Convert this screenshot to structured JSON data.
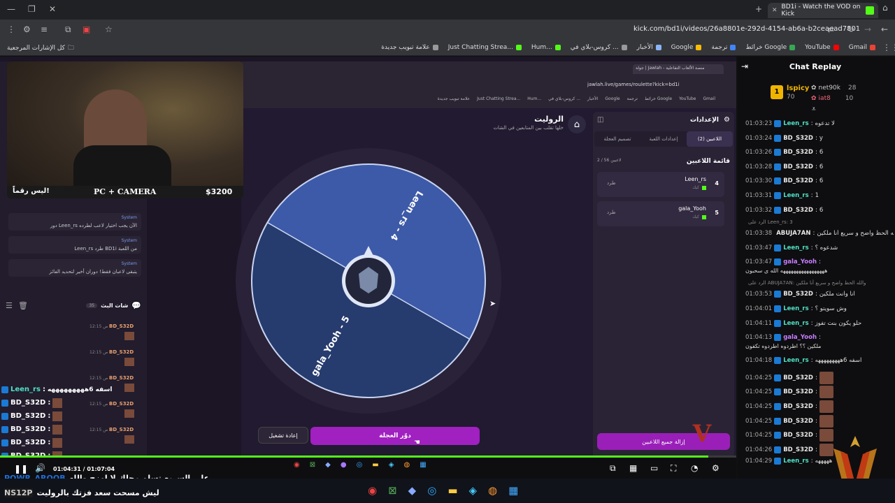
{
  "browser": {
    "tab_title": "BD1i - Watch the VOD on Kick",
    "new_tab": "+",
    "url": "kick.com/bd1i/videos/26a8801e-292d-4154-ab6a-b2ceaead7801",
    "bookmarks_folder": "كل الإشارات المرجعية",
    "bookmarks": [
      {
        "label": "Gmail",
        "color": "#ea4335"
      },
      {
        "label": "YouTube",
        "color": "#ff0000"
      },
      {
        "label": "خرائط Google",
        "color": "#34a853"
      },
      {
        "label": "ترجمة",
        "color": "#4285f4"
      },
      {
        "label": "Google",
        "color": "#fbbc05"
      },
      {
        "label": "الأخبار",
        "color": "#8ab4f8"
      },
      {
        "label": "كروس-بلاي في ...",
        "color": "#999999"
      },
      {
        "label": "Hum...",
        "color": "#53fc18"
      },
      {
        "label": "Just Chatting Strea...",
        "color": "#53fc18"
      },
      {
        "label": "علامة تبويب جديدة",
        "color": "#999999"
      }
    ]
  },
  "inner_browser": {
    "tab_title": "جولة | Jawlah - منصة الألعاب التفاعلية",
    "url": "jawlah.live/games/roulette?kick=bd1i",
    "bookmarks": [
      "Gmail",
      "YouTube",
      "خرائط Google",
      "ترجمة",
      "Google",
      "الأخبار",
      "كروس-بلاي في ...",
      "Hum...",
      "Just Chatting Strea...",
      "علامة تبويب جديدة"
    ]
  },
  "game": {
    "title": "الروليت",
    "subtitle": "خلها تقلب بين المتابعين في الشات",
    "wheel_segments": [
      "Leen_rs - 4",
      "gala_Yooh - 5"
    ],
    "spin_button": "دوّر العجلة",
    "replay_button": "إعادة تشغيل"
  },
  "settings": {
    "header": "الإعدادات",
    "tabs": [
      "اللاعبين (2)",
      "إعدادات اللعبة",
      "تصميم العجلة"
    ],
    "list_title": "قائمة اللاعبين",
    "count": "2 / 56 لاعبين",
    "players": [
      {
        "num": "4",
        "name": "Leen_rs",
        "sub": "كيك",
        "kick": "طرد"
      },
      {
        "num": "5",
        "name": "gala_Yooh",
        "sub": "كيك",
        "kick": "طرد"
      }
    ],
    "remove_all": "إزالة جميع اللاعبين"
  },
  "webcam": {
    "left_caption": "ليس رقماً!",
    "center_caption": "PC + CAMERA",
    "right_caption": "$3200"
  },
  "left_chat": {
    "header": "شات البث",
    "count": "35",
    "system_label": "System",
    "system_messages": [
      "دور Leen_rs الآن يجب اختيار لاعب لطرده",
      "Leen_rs طرد BD1i من اللعبة",
      "يتبقى لاعبان فقط! دوران أخير لتحديد الفائز"
    ],
    "mini_user": "BD_S32D",
    "mini_time": "12:15 ص",
    "overlay_lines": [
      {
        "user": "Leen_rs",
        "text": "اسفه 6هههههههههه"
      },
      {
        "user": "BD_S32D",
        "text": ""
      },
      {
        "user": "BD_S32D",
        "text": ""
      },
      {
        "user": "BD_S32D",
        "text": ""
      },
      {
        "user": "BD_S32D",
        "text": ""
      },
      {
        "user": "BD_S32D",
        "text": ""
      }
    ]
  },
  "player": {
    "current": "01:04:31",
    "sep": "/",
    "total": "01:07:04",
    "progress": 0.962
  },
  "subtitle_overlay": {
    "line1_user": "POWR_AROOB",
    "line1_text": "على السريع تسلم رجلك لا امزح والله",
    "line2_user": "NS12P",
    "line2_text": "ليش مسحت سعد فزتك بالروليت"
  },
  "chat_replay": {
    "title": "Chat Replay",
    "top_users": [
      {
        "rank": "1",
        "name": "lspicy",
        "count": "70"
      },
      {
        "name": "net90k",
        "count": "28"
      },
      {
        "name": "iat8",
        "count": "10"
      }
    ],
    "messages": [
      {
        "time": "01:03:23",
        "user": "Leen_rs",
        "color": "#4fe0c4",
        "text": "لا تدعوه"
      },
      {
        "time": "01:03:24",
        "user": "BD_S32D",
        "color": "#e8e8e8",
        "text": "y"
      },
      {
        "time": "01:03:26",
        "user": "BD_S32D",
        "color": "#e8e8e8",
        "text": "6"
      },
      {
        "time": "01:03:28",
        "user": "BD_S32D",
        "color": "#e8e8e8",
        "text": "6"
      },
      {
        "time": "01:03:30",
        "user": "BD_S32D",
        "color": "#e8e8e8",
        "text": "6"
      },
      {
        "time": "01:03:31",
        "user": "Leen_rs",
        "color": "#4fe0c4",
        "text": "1"
      },
      {
        "time": "01:03:32",
        "user": "BD_S32D",
        "color": "#e8e8e8",
        "text": "6"
      },
      {
        "time": "01:03:38",
        "user": "ABUJA7AN",
        "color": "#e8e8e8",
        "text": "والله الحظ واضح و سريع أنا ملكين",
        "reply": "الرد على Leen_rs: 3"
      },
      {
        "time": "01:03:47",
        "user": "Leen_rs",
        "color": "#4fe0c4",
        "text": "شدعوه ؟"
      },
      {
        "time": "01:03:47",
        "user": "gala_Yooh",
        "color": "#c77dff",
        "text": "هههههههههههههههههه الله ي سحبون"
      },
      {
        "time": "01:03:53",
        "user": "BD_S32D",
        "color": "#e8e8e8",
        "text": "انا وانت ملكين",
        "reply": "الرد على ABUJA7AN: والله الحظ واضح و سريع أنا ملكين"
      },
      {
        "time": "01:04:01",
        "user": "Leen_rs",
        "color": "#4fe0c4",
        "text": "وش سويتو ؟"
      },
      {
        "time": "01:04:11",
        "user": "Leen_rs",
        "color": "#4fe0c4",
        "text": "حلو يكون بنت تفوز"
      },
      {
        "time": "01:04:13",
        "user": "gala_Yooh",
        "color": "#c77dff",
        "text": "ملكين ؟؟ اطردوه اطردوه تكفون"
      },
      {
        "time": "01:04:18",
        "user": "Leen_rs",
        "color": "#4fe0c4",
        "text": "اسفه 6هههههههههه"
      },
      {
        "time": "01:04:25",
        "user": "BD_S32D",
        "color": "#e8e8e8",
        "text": ""
      },
      {
        "time": "01:04:25",
        "user": "BD_S32D",
        "color": "#e8e8e8",
        "text": ""
      },
      {
        "time": "01:04:25",
        "user": "BD_S32D",
        "color": "#e8e8e8",
        "text": ""
      },
      {
        "time": "01:04:25",
        "user": "BD_S32D",
        "color": "#e8e8e8",
        "text": ""
      },
      {
        "time": "01:04:25",
        "user": "BD_S32D",
        "color": "#e8e8e8",
        "text": ""
      },
      {
        "time": "01:04:26",
        "user": "BD_S32D",
        "color": "#e8e8e8",
        "text": ""
      },
      {
        "time": "01:04:29",
        "user": "Leen_rs",
        "color": "#4fe0c4",
        "text": "هههههه"
      }
    ]
  },
  "colors": {
    "kick_green": "#53fc18",
    "purple": "#a020c0",
    "wheel_light": "#3d5aa8",
    "wheel_dark": "#263b6e"
  }
}
